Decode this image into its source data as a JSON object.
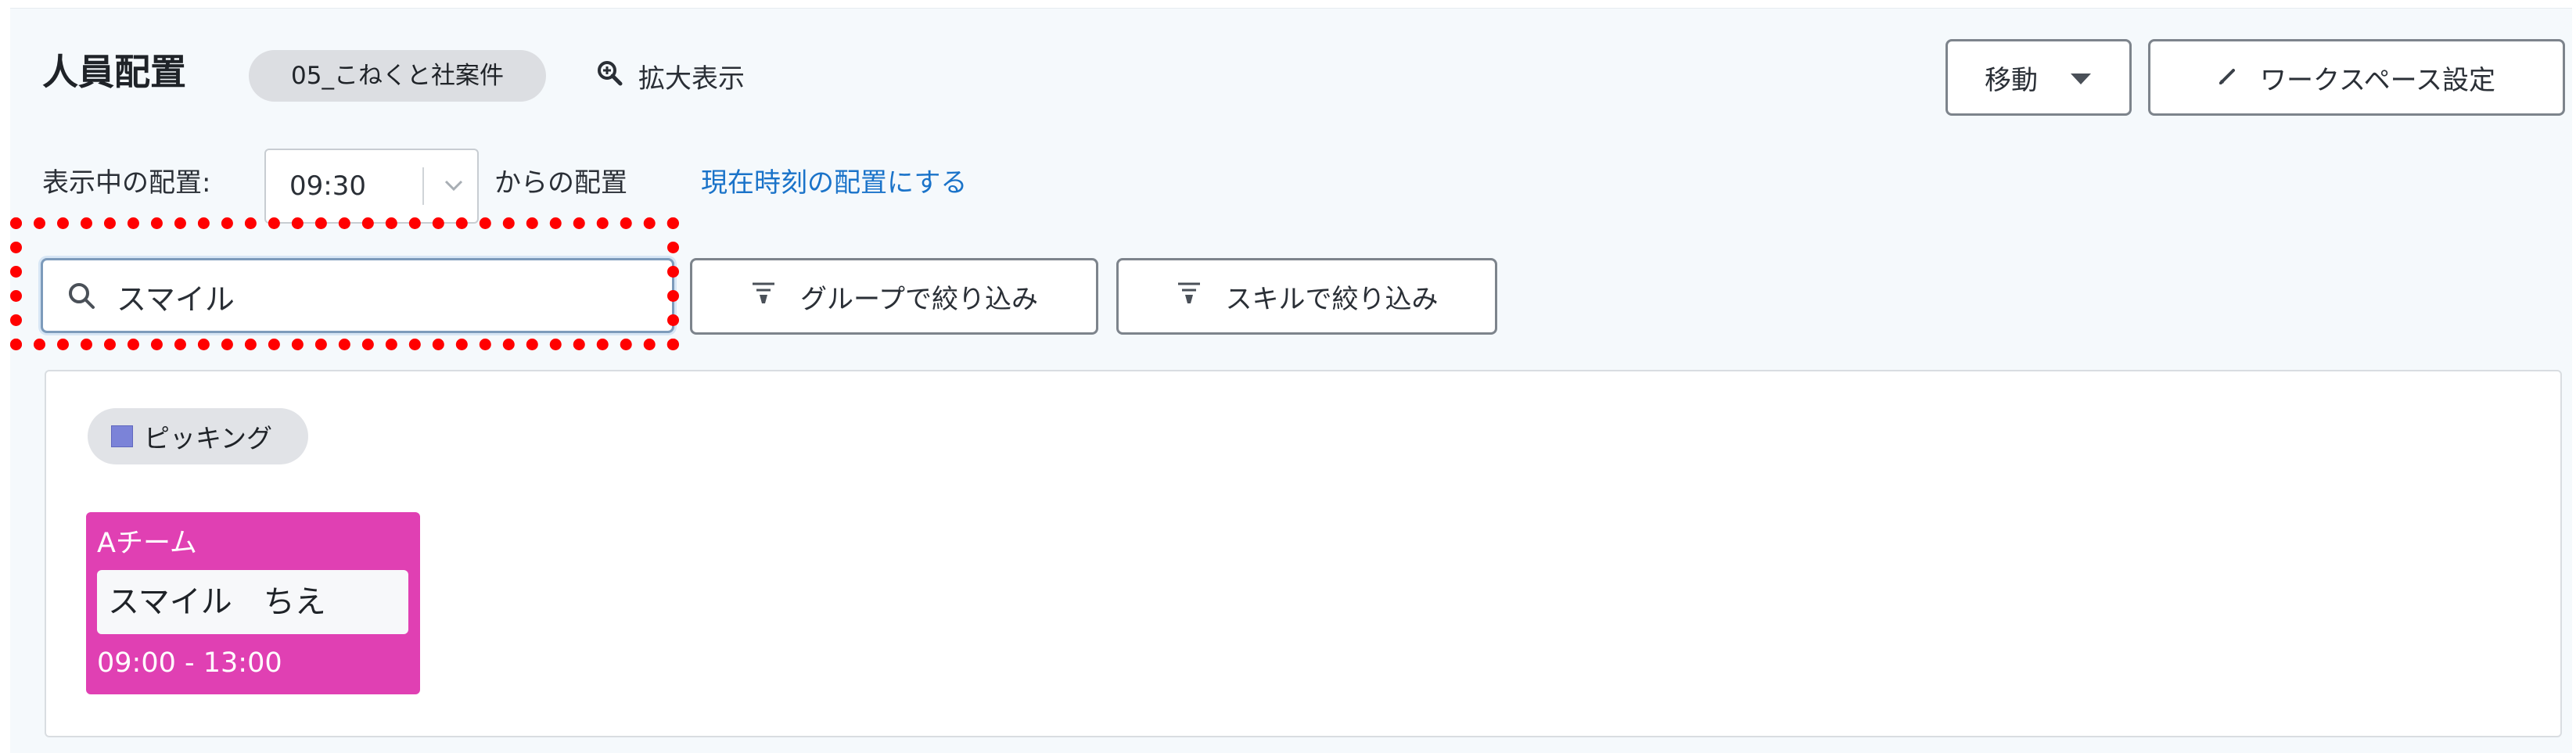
{
  "header": {
    "title": "人員配置",
    "workspace_badge": "05_こねくと社案件",
    "zoom_label": "拡大表示",
    "move_button": "移動",
    "workspace_settings_button": "ワークスペース設定"
  },
  "time_row": {
    "prefix_label": "表示中の配置:",
    "time_value": "09:30",
    "suffix_label": "からの配置",
    "now_link": "現在時刻の配置にする"
  },
  "filters": {
    "search_value": "スマイル",
    "group_filter_button": "グループで絞り込み",
    "skill_filter_button": "スキルで絞り込み"
  },
  "board": {
    "area_chip": {
      "label": "ピッキング",
      "color": "#7b83d8"
    },
    "cards": [
      {
        "team": "Aチーム",
        "member": "スマイル　ちえ",
        "hours": "09:00 - 13:00",
        "color": "#e040b3"
      }
    ]
  },
  "colors": {
    "link": "#1a73c9",
    "highlight": "#ff0000"
  }
}
